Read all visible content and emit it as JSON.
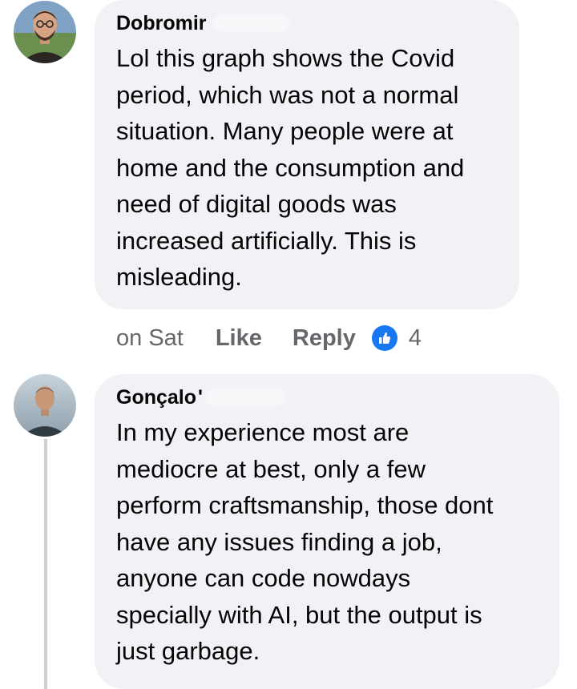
{
  "comments": [
    {
      "author": "Dobromir",
      "text": "Lol this graph shows the Covid\nperiod, which was not a normal\nsituation. Many people were at\nhome and the consumption and\nneed of digital goods was\nincreased artificially. This is\nmisleading.",
      "time": "on Sat",
      "like_label": "Like",
      "reply_label": "Reply",
      "reaction_icon": "thumbs-up-icon",
      "reaction_count": "4"
    },
    {
      "author": "Gonçalo",
      "author_suffix": "'",
      "text": "In my experience most are\nmediocre at best, only a few\nperform craftsmanship, those dont\nhave any issues finding a job,\nanyone can code nowdays\nspecially with AI, but the output is\njust garbage."
    }
  ],
  "colors": {
    "bubble": "#f0f2f5",
    "meta_text": "#65676b",
    "like_blue": "#1877f2",
    "thread_line": "#ced0d4"
  }
}
